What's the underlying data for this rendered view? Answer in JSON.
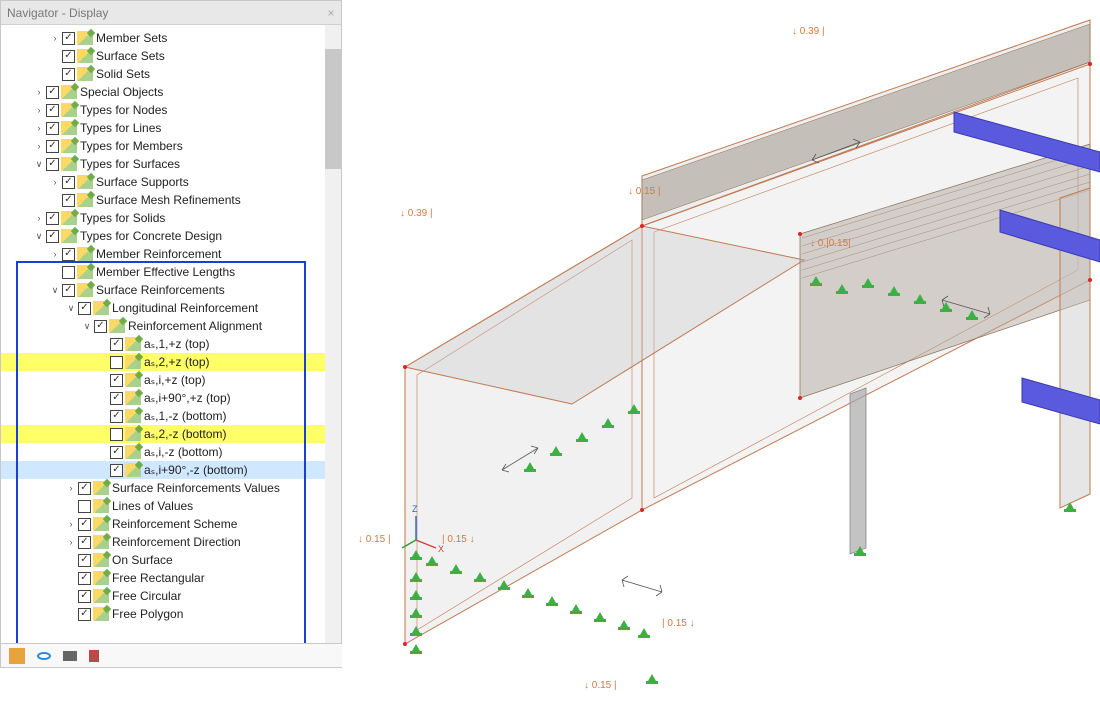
{
  "panel": {
    "title": "Navigator - Display"
  },
  "tree": [
    {
      "indent": 3,
      "expander": ">",
      "checked": true,
      "label": "Member Sets"
    },
    {
      "indent": 3,
      "expander": "",
      "checked": true,
      "label": "Surface Sets"
    },
    {
      "indent": 3,
      "expander": "",
      "checked": true,
      "label": "Solid Sets"
    },
    {
      "indent": 2,
      "expander": ">",
      "checked": true,
      "label": "Special Objects"
    },
    {
      "indent": 2,
      "expander": ">",
      "checked": true,
      "label": "Types for Nodes"
    },
    {
      "indent": 2,
      "expander": ">",
      "checked": true,
      "label": "Types for Lines"
    },
    {
      "indent": 2,
      "expander": ">",
      "checked": true,
      "label": "Types for Members"
    },
    {
      "indent": 2,
      "expander": "v",
      "checked": true,
      "label": "Types for Surfaces"
    },
    {
      "indent": 3,
      "expander": ">",
      "checked": true,
      "label": "Surface Supports"
    },
    {
      "indent": 3,
      "expander": "",
      "checked": true,
      "label": "Surface Mesh Refinements"
    },
    {
      "indent": 2,
      "expander": ">",
      "checked": true,
      "label": "Types for Solids"
    },
    {
      "indent": 2,
      "expander": "v",
      "checked": true,
      "label": "Types for Concrete Design"
    },
    {
      "indent": 3,
      "expander": ">",
      "checked": true,
      "label": "Member Reinforcement"
    },
    {
      "indent": 3,
      "expander": "",
      "checked": false,
      "label": "Member Effective Lengths"
    },
    {
      "indent": 3,
      "expander": "v",
      "checked": true,
      "label": "Surface Reinforcements"
    },
    {
      "indent": 4,
      "expander": "v",
      "checked": true,
      "label": "Longitudinal Reinforcement"
    },
    {
      "indent": 5,
      "expander": "v",
      "checked": true,
      "label": "Reinforcement Alignment"
    },
    {
      "indent": 6,
      "expander": "",
      "checked": true,
      "label": "aₛ,1,+z (top)"
    },
    {
      "indent": 6,
      "expander": "",
      "checked": false,
      "label": "aₛ,2,+z (top)",
      "highlighted": true
    },
    {
      "indent": 6,
      "expander": "",
      "checked": true,
      "label": "aₛ,i,+z (top)"
    },
    {
      "indent": 6,
      "expander": "",
      "checked": true,
      "label": "aₛ,i+90°,+z (top)"
    },
    {
      "indent": 6,
      "expander": "",
      "checked": true,
      "label": "aₛ,1,-z (bottom)"
    },
    {
      "indent": 6,
      "expander": "",
      "checked": false,
      "label": "aₛ,2,-z (bottom)",
      "highlighted": true
    },
    {
      "indent": 6,
      "expander": "",
      "checked": true,
      "label": "aₛ,i,-z (bottom)"
    },
    {
      "indent": 6,
      "expander": "",
      "checked": true,
      "label": "aₛ,i+90°,-z (bottom)",
      "selected": true
    },
    {
      "indent": 4,
      "expander": ">",
      "checked": true,
      "label": "Surface Reinforcements Values"
    },
    {
      "indent": 4,
      "expander": "",
      "checked": false,
      "label": "Lines of Values"
    },
    {
      "indent": 4,
      "expander": ">",
      "checked": true,
      "label": "Reinforcement Scheme"
    },
    {
      "indent": 4,
      "expander": ">",
      "checked": true,
      "label": "Reinforcement Direction"
    },
    {
      "indent": 4,
      "expander": "",
      "checked": true,
      "label": "On Surface"
    },
    {
      "indent": 4,
      "expander": "",
      "checked": true,
      "label": "Free Rectangular"
    },
    {
      "indent": 4,
      "expander": "",
      "checked": true,
      "label": "Free Circular"
    },
    {
      "indent": 4,
      "expander": "",
      "checked": true,
      "label": "Free Polygon"
    }
  ],
  "dims": {
    "d039a": "↓ 0.39 |",
    "d039b": "↓ 0.39 |",
    "d015a": "↓ 0.15 |",
    "d015b": "| 0.15 ↓",
    "d015c": "| 0.15 ↓",
    "d015d": "↓ 0.15 |",
    "d015e": "↓ 0.15 |",
    "d001": "↓ 0.|0.15|"
  },
  "axis": {
    "z": "Z",
    "x": "X"
  }
}
